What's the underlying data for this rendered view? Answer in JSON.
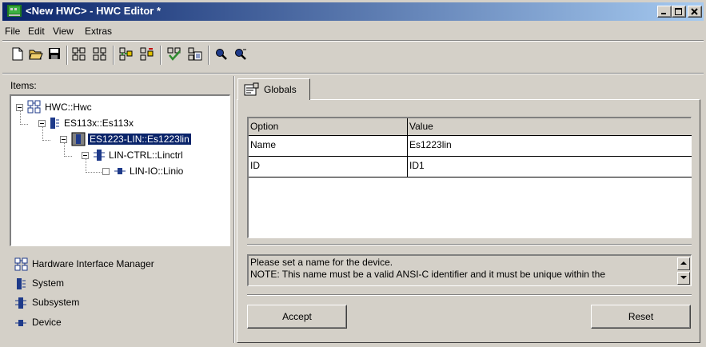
{
  "window": {
    "title": "<New HWC> - HWC Editor  *",
    "minimize_icon": "minimize-icon",
    "maximize_icon": "maximize-icon",
    "close_icon": "close-icon"
  },
  "menu": [
    "File",
    "Edit",
    "View",
    "Extras"
  ],
  "toolbar": {
    "icons": [
      "new-file-icon",
      "open-folder-icon",
      "save-icon",
      "add-item-icon",
      "remove-item-icon",
      "add-child-icon",
      "remove-child-icon",
      "check-icon",
      "generate-icon",
      "search-icon",
      "search-next-icon"
    ]
  },
  "left": {
    "items_label": "Items:",
    "tree": [
      {
        "label": "HWC::Hwc",
        "icon": "hardware-interface-manager-icon",
        "level": 0
      },
      {
        "label": "ES113x::Es113x",
        "icon": "system-icon",
        "level": 1
      },
      {
        "label": "ES1223-LIN::Es1223lin",
        "icon": "board-icon",
        "level": 2,
        "selected": true
      },
      {
        "label": "LIN-CTRL::Linctrl",
        "icon": "subsystem-icon",
        "level": 3
      },
      {
        "label": "LIN-IO::Linio",
        "icon": "device-icon",
        "level": 4
      }
    ],
    "legend": [
      {
        "label": "Hardware Interface Manager",
        "icon": "hardware-interface-manager-icon"
      },
      {
        "label": "System",
        "icon": "system-icon"
      },
      {
        "label": "Subsystem",
        "icon": "subsystem-icon"
      },
      {
        "label": "Device",
        "icon": "device-icon"
      }
    ]
  },
  "right": {
    "tab_label": "Globals",
    "grid": {
      "headers": [
        "Option",
        "Value"
      ],
      "rows": [
        [
          "Name",
          "Es1223lin"
        ],
        [
          "ID",
          "ID1"
        ]
      ]
    },
    "message": [
      "Please set a name for the device.",
      "NOTE: This name must be a valid ANSI-C identifier and it must be unique within the"
    ],
    "accept_label": "Accept",
    "reset_label": "Reset"
  },
  "colors": {
    "title_gradient_start": "#0a246a",
    "title_gradient_end": "#a6caf0",
    "selection": "#0a246a",
    "face": "#d4d0c8",
    "icon_blue": "#1e3a8a",
    "icon_green": "#2e8b2e",
    "icon_yellow": "#e0c000"
  }
}
